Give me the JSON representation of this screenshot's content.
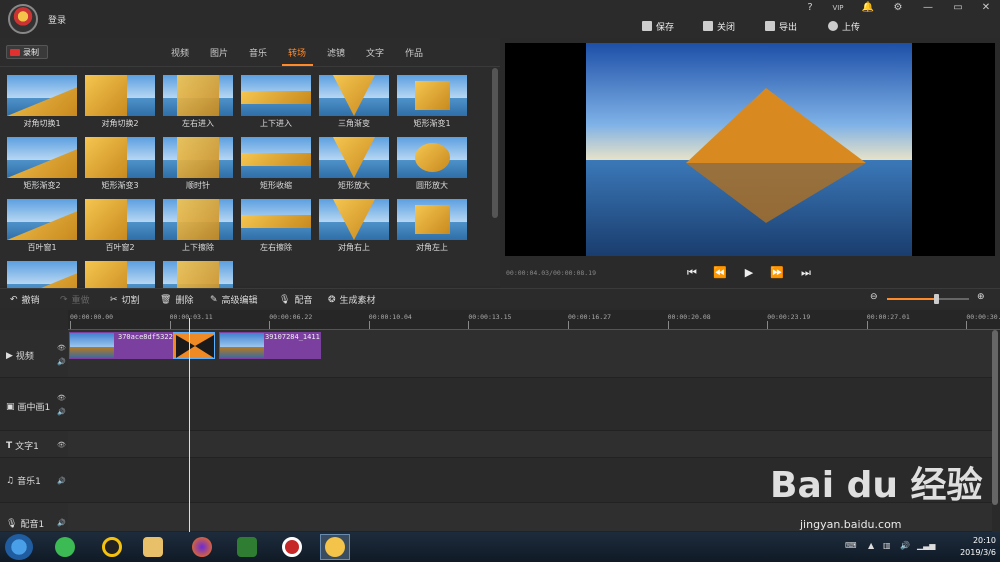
{
  "titlebar": {
    "login": "登录",
    "window_controls": [
      "?",
      "VIP",
      "🔔",
      "⚙",
      "—",
      "▭",
      "✕"
    ],
    "actions": [
      {
        "label": "保存",
        "icon": "save-icon"
      },
      {
        "label": "关闭",
        "icon": "exit-icon"
      },
      {
        "label": "导出",
        "icon": "export-icon"
      },
      {
        "label": "上传",
        "icon": "cloud-upload-icon"
      }
    ]
  },
  "left_panel": {
    "record_label": "录制",
    "tabs": [
      "视频",
      "图片",
      "音乐",
      "转场",
      "滤镜",
      "文字",
      "作品"
    ],
    "active_tab": "转场",
    "transitions": [
      "对角切换1",
      "对角切换2",
      "左右进入",
      "上下进入",
      "三角渐变",
      "矩形渐变1",
      "矩形渐变2",
      "矩形渐变3",
      "顺时针",
      "矩形收缩",
      "矩形放大",
      "圆形放大",
      "百叶窗1",
      "百叶窗2",
      "上下擦除",
      "左右擦除",
      "对角右上",
      "对角左上",
      "",
      "",
      ""
    ]
  },
  "preview": {
    "timecode": "00:00:04.03/00:00:08.19",
    "controls": [
      "⏮",
      "⏪",
      "▶",
      "⏩",
      "⏭"
    ]
  },
  "toolbar": {
    "undo": "撤销",
    "redo": "重做",
    "cut": "切割",
    "delete": "删除",
    "advanced_edit": "高级编辑",
    "dub": "配音",
    "generate": "生成素材",
    "zoom_level": 0.6
  },
  "timeline": {
    "ruler": [
      "00:00:00.00",
      "00:00:03.11",
      "00:00:06.22",
      "00:00:10.04",
      "00:00:13.15",
      "00:00:16.27",
      "00:00:20.08",
      "00:00:23.19",
      "00:00:27.01",
      "00:00:30."
    ],
    "tracks": [
      {
        "label": "视频",
        "icon": "play-icon"
      },
      {
        "label": "画中画1",
        "icon": "pip-icon"
      },
      {
        "label": "文字1",
        "icon": "text-icon"
      },
      {
        "label": "音乐1",
        "icon": "music-icon"
      },
      {
        "label": "配音1",
        "icon": "mic-icon"
      }
    ],
    "clips": [
      {
        "name": "370ace8df5322"
      },
      {
        "name": "39107284_1411"
      }
    ]
  },
  "taskbar": {
    "time": "20:10",
    "date": "2019/3/6"
  },
  "watermark": {
    "logo": "Bai du 经验",
    "url": "jingyan.baidu.com"
  }
}
